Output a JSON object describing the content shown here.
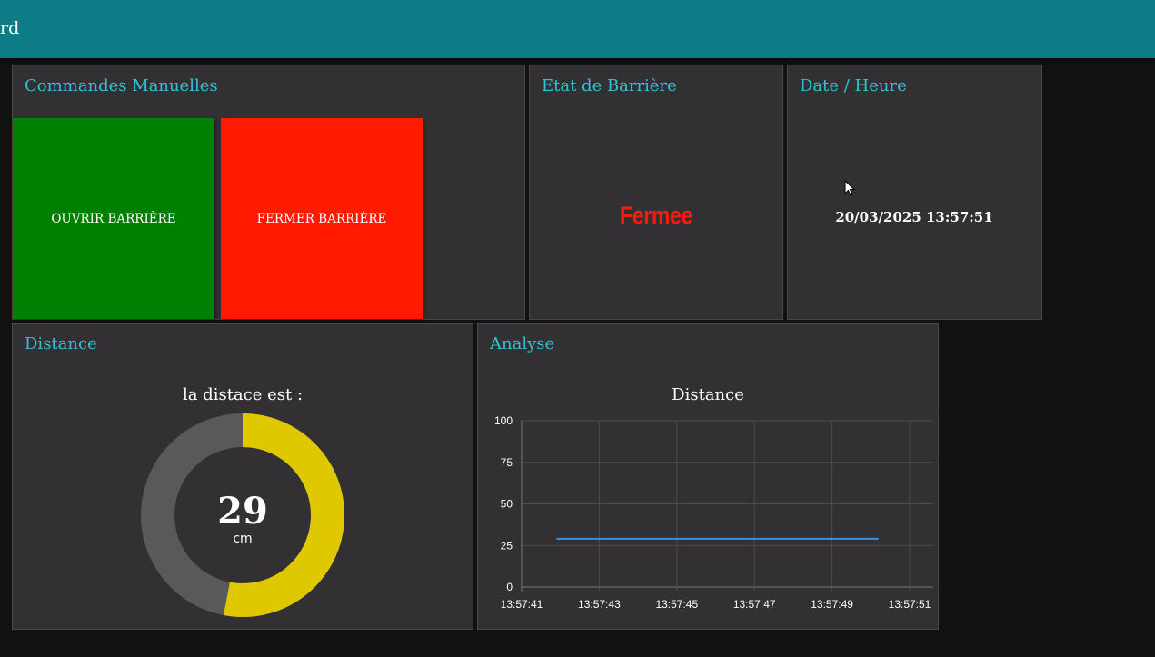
{
  "header": {
    "title": "rd"
  },
  "commands": {
    "title": "Commandes Manuelles",
    "open_label": "OUVRIR BARRIÈRE",
    "close_label": "FERMER BARRIÈRE",
    "open_color": "#008000",
    "close_color": "#ff1a00"
  },
  "barrier": {
    "title": "Etat de Barrière",
    "state": "Fermee",
    "state_color": "#ff1a0a"
  },
  "datetime": {
    "title": "Date / Heure",
    "value": "20/03/2025 13:57:51"
  },
  "distance": {
    "title": "Distance",
    "label": "la distace est :",
    "value": "29",
    "unit": "cm",
    "gauge_fill_fraction": 0.53,
    "fill_color": "#e0c800",
    "track_color": "#5a585a"
  },
  "analysis": {
    "title": "Analyse"
  },
  "chart_data": {
    "type": "line",
    "title": "Distance",
    "xlabel": "",
    "ylabel": "",
    "ylim": [
      0,
      100
    ],
    "yticks": [
      "0",
      "25",
      "50",
      "75",
      "100"
    ],
    "xticks": [
      "13:57:41",
      "13:57:43",
      "13:57:45",
      "13:57:47",
      "13:57:49",
      "13:57:51"
    ],
    "xlim": [
      0,
      10
    ],
    "grid": true,
    "series": [
      {
        "color": "#3b8fd9",
        "x": [
          0.9,
          9.2
        ],
        "y": [
          29,
          29
        ]
      }
    ]
  }
}
